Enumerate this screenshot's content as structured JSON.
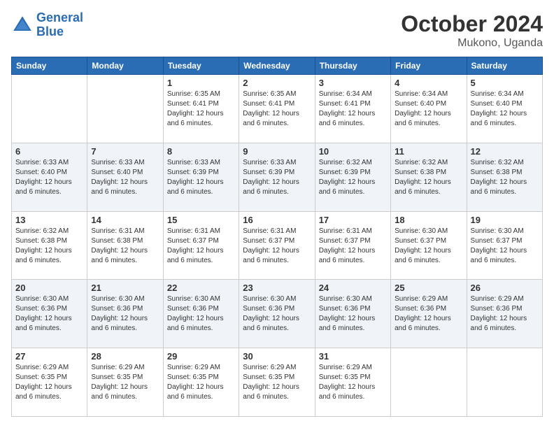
{
  "logo": {
    "line1": "General",
    "line2": "Blue"
  },
  "header": {
    "month": "October 2024",
    "location": "Mukono, Uganda"
  },
  "weekdays": [
    "Sunday",
    "Monday",
    "Tuesday",
    "Wednesday",
    "Thursday",
    "Friday",
    "Saturday"
  ],
  "weeks": [
    [
      {
        "day": "",
        "info": ""
      },
      {
        "day": "",
        "info": ""
      },
      {
        "day": "1",
        "info": "Sunrise: 6:35 AM\nSunset: 6:41 PM\nDaylight: 12 hours\nand 6 minutes."
      },
      {
        "day": "2",
        "info": "Sunrise: 6:35 AM\nSunset: 6:41 PM\nDaylight: 12 hours\nand 6 minutes."
      },
      {
        "day": "3",
        "info": "Sunrise: 6:34 AM\nSunset: 6:41 PM\nDaylight: 12 hours\nand 6 minutes."
      },
      {
        "day": "4",
        "info": "Sunrise: 6:34 AM\nSunset: 6:40 PM\nDaylight: 12 hours\nand 6 minutes."
      },
      {
        "day": "5",
        "info": "Sunrise: 6:34 AM\nSunset: 6:40 PM\nDaylight: 12 hours\nand 6 minutes."
      }
    ],
    [
      {
        "day": "6",
        "info": "Sunrise: 6:33 AM\nSunset: 6:40 PM\nDaylight: 12 hours\nand 6 minutes."
      },
      {
        "day": "7",
        "info": "Sunrise: 6:33 AM\nSunset: 6:40 PM\nDaylight: 12 hours\nand 6 minutes."
      },
      {
        "day": "8",
        "info": "Sunrise: 6:33 AM\nSunset: 6:39 PM\nDaylight: 12 hours\nand 6 minutes."
      },
      {
        "day": "9",
        "info": "Sunrise: 6:33 AM\nSunset: 6:39 PM\nDaylight: 12 hours\nand 6 minutes."
      },
      {
        "day": "10",
        "info": "Sunrise: 6:32 AM\nSunset: 6:39 PM\nDaylight: 12 hours\nand 6 minutes."
      },
      {
        "day": "11",
        "info": "Sunrise: 6:32 AM\nSunset: 6:38 PM\nDaylight: 12 hours\nand 6 minutes."
      },
      {
        "day": "12",
        "info": "Sunrise: 6:32 AM\nSunset: 6:38 PM\nDaylight: 12 hours\nand 6 minutes."
      }
    ],
    [
      {
        "day": "13",
        "info": "Sunrise: 6:32 AM\nSunset: 6:38 PM\nDaylight: 12 hours\nand 6 minutes."
      },
      {
        "day": "14",
        "info": "Sunrise: 6:31 AM\nSunset: 6:38 PM\nDaylight: 12 hours\nand 6 minutes."
      },
      {
        "day": "15",
        "info": "Sunrise: 6:31 AM\nSunset: 6:37 PM\nDaylight: 12 hours\nand 6 minutes."
      },
      {
        "day": "16",
        "info": "Sunrise: 6:31 AM\nSunset: 6:37 PM\nDaylight: 12 hours\nand 6 minutes."
      },
      {
        "day": "17",
        "info": "Sunrise: 6:31 AM\nSunset: 6:37 PM\nDaylight: 12 hours\nand 6 minutes."
      },
      {
        "day": "18",
        "info": "Sunrise: 6:30 AM\nSunset: 6:37 PM\nDaylight: 12 hours\nand 6 minutes."
      },
      {
        "day": "19",
        "info": "Sunrise: 6:30 AM\nSunset: 6:37 PM\nDaylight: 12 hours\nand 6 minutes."
      }
    ],
    [
      {
        "day": "20",
        "info": "Sunrise: 6:30 AM\nSunset: 6:36 PM\nDaylight: 12 hours\nand 6 minutes."
      },
      {
        "day": "21",
        "info": "Sunrise: 6:30 AM\nSunset: 6:36 PM\nDaylight: 12 hours\nand 6 minutes."
      },
      {
        "day": "22",
        "info": "Sunrise: 6:30 AM\nSunset: 6:36 PM\nDaylight: 12 hours\nand 6 minutes."
      },
      {
        "day": "23",
        "info": "Sunrise: 6:30 AM\nSunset: 6:36 PM\nDaylight: 12 hours\nand 6 minutes."
      },
      {
        "day": "24",
        "info": "Sunrise: 6:30 AM\nSunset: 6:36 PM\nDaylight: 12 hours\nand 6 minutes."
      },
      {
        "day": "25",
        "info": "Sunrise: 6:29 AM\nSunset: 6:36 PM\nDaylight: 12 hours\nand 6 minutes."
      },
      {
        "day": "26",
        "info": "Sunrise: 6:29 AM\nSunset: 6:36 PM\nDaylight: 12 hours\nand 6 minutes."
      }
    ],
    [
      {
        "day": "27",
        "info": "Sunrise: 6:29 AM\nSunset: 6:35 PM\nDaylight: 12 hours\nand 6 minutes."
      },
      {
        "day": "28",
        "info": "Sunrise: 6:29 AM\nSunset: 6:35 PM\nDaylight: 12 hours\nand 6 minutes."
      },
      {
        "day": "29",
        "info": "Sunrise: 6:29 AM\nSunset: 6:35 PM\nDaylight: 12 hours\nand 6 minutes."
      },
      {
        "day": "30",
        "info": "Sunrise: 6:29 AM\nSunset: 6:35 PM\nDaylight: 12 hours\nand 6 minutes."
      },
      {
        "day": "31",
        "info": "Sunrise: 6:29 AM\nSunset: 6:35 PM\nDaylight: 12 hours\nand 6 minutes."
      },
      {
        "day": "",
        "info": ""
      },
      {
        "day": "",
        "info": ""
      }
    ]
  ]
}
